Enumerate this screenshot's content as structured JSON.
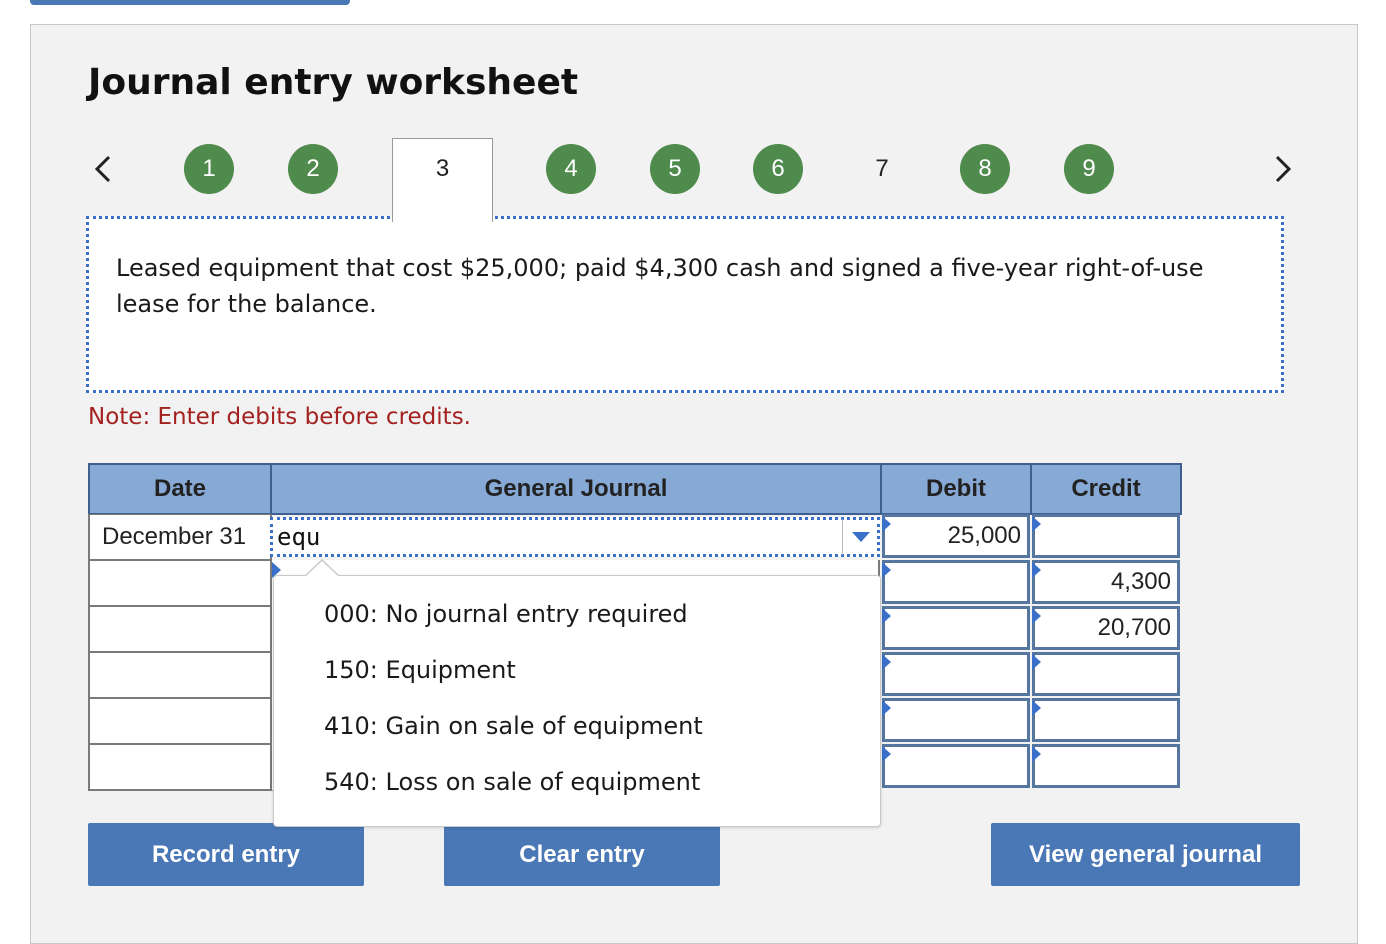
{
  "worksheet": {
    "title": "Journal entry worksheet",
    "nav": {
      "prev_icon": "chevron-left-icon",
      "next_icon": "chevron-right-icon"
    },
    "steps": [
      "1",
      "2",
      "3",
      "4",
      "5",
      "6",
      "7",
      "8",
      "9"
    ],
    "active_step": "3",
    "completed_color": "#4e8b4d",
    "description": "Leased equipment that cost $25,000; paid $4,300 cash and signed a five-year right-of-use lease for the balance.",
    "note": "Note: Enter debits before credits."
  },
  "table": {
    "headers": {
      "date": "Date",
      "journal": "General Journal",
      "debit": "Debit",
      "credit": "Credit"
    },
    "rows": [
      {
        "date": "December 31",
        "account": "equ",
        "debit": "25,000",
        "credit": ""
      },
      {
        "date": "",
        "account": "",
        "debit": "",
        "credit": "4,300"
      },
      {
        "date": "",
        "account": "",
        "debit": "",
        "credit": "20,700"
      },
      {
        "date": "",
        "account": "",
        "debit": "",
        "credit": ""
      },
      {
        "date": "",
        "account": "",
        "debit": "",
        "credit": ""
      },
      {
        "date": "",
        "account": "",
        "debit": "",
        "credit": ""
      }
    ]
  },
  "dropdown": {
    "options": [
      "000: No journal entry required",
      "150: Equipment",
      "410: Gain on sale of equipment",
      "540: Loss on sale of equipment"
    ]
  },
  "buttons": {
    "record": "Record entry",
    "clear": "Clear entry",
    "view": "View general journal"
  },
  "colors": {
    "accent": "#4a77b6",
    "header_bg": "#87a9d6",
    "note": "#a3211f",
    "focus_dotted": "#3a70c9"
  }
}
